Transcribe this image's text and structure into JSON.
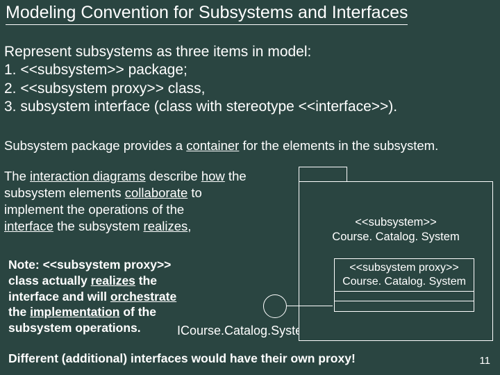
{
  "title": "Modeling Convention for Subsystems and Interfaces",
  "intro": {
    "lead": "Represent subsystems as three items in model:",
    "item1": "1.  <<subsystem>> package;",
    "item2": "2.  <<subsystem proxy>> class,",
    "item3": "3.  subsystem interface (class with stereotype <<interface>>)."
  },
  "container_pre": "Subsystem package provides a ",
  "container_u": "container",
  "container_post": " for the elements in the subsystem.",
  "interaction": {
    "t1a": "The ",
    "t1u": "interaction diagrams",
    "t1b": " describe ",
    "t1u2": "how",
    "t1c": " the",
    "t2a": "subsystem elements ",
    "t2u": "collaborate",
    "t2b": " to",
    "t3": " implement the operations of the",
    "t4a": " ",
    "t4u": "interface",
    "t4b": " the subsystem ",
    "t4u2": "realizes",
    "t4c": ","
  },
  "note": {
    "n1": "Note:  <<subsystem proxy>>",
    "n2a": " class actually ",
    "n2u": "realizes",
    "n2b": " the",
    "n3a": " interface and will ",
    "n3u": "orchestrate",
    "n4a": " the ",
    "n4u": "implementation",
    "n4b": " of the",
    "n5": " subsystem operations."
  },
  "iface_label": "ICourse.Catalog.System",
  "footer": "Different (additional) interfaces would have their own proxy!",
  "slide_num": "11",
  "package": {
    "stereo": "<<subsystem>>",
    "name": "Course. Catalog. System"
  },
  "proxy": {
    "stereo": "<<subsystem proxy>>",
    "name": "Course. Catalog. System"
  }
}
